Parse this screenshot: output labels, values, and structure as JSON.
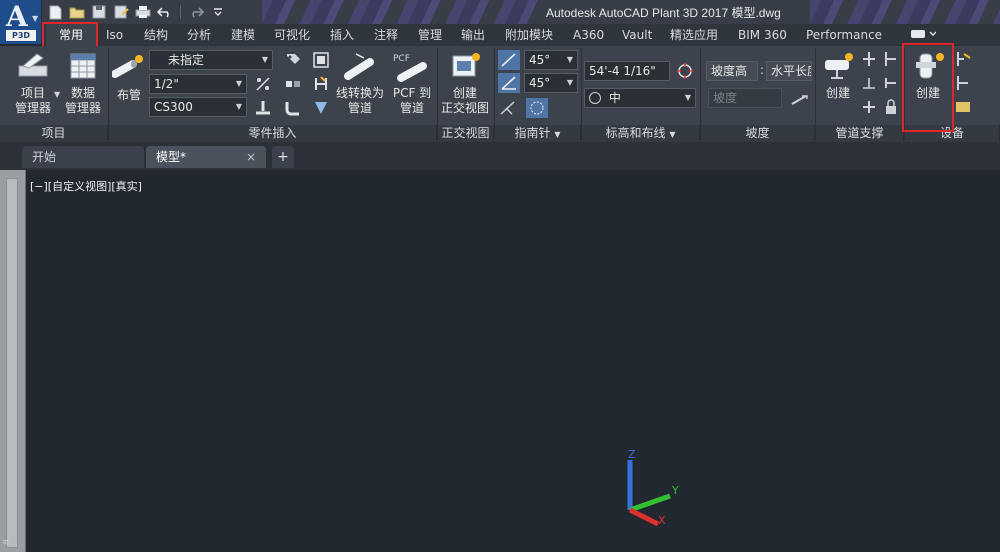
{
  "app": {
    "window_title": "Autodesk AutoCAD Plant 3D 2017    模型.dwg",
    "badge": "P3D",
    "logo_letter": "A"
  },
  "quick_access": {
    "icons": [
      "new-icon",
      "open-icon",
      "save-icon",
      "saveas-icon",
      "print-icon",
      "undo-icon",
      "redo-icon",
      "dropdown-icon"
    ]
  },
  "ribbon_tabs": [
    "常用",
    "Iso",
    "结构",
    "分析",
    "建模",
    "可视化",
    "插入",
    "注释",
    "管理",
    "输出",
    "附加模块",
    "A360",
    "Vault",
    "精选应用",
    "BIM 360",
    "Performance"
  ],
  "active_tab": "常用",
  "panels": {
    "project": {
      "title": "项目",
      "project_manager": "项目\n管理器",
      "data_manager": "数据\n管理器"
    },
    "part_insert": {
      "title": "零件插入",
      "route_pipe": "布管",
      "spec_combo": "未指定",
      "size_combo": "1/2\"",
      "class_combo": "CS300",
      "line_to_pipe": "线转换为\n管道",
      "pcf_to_pipe": "PCF 到\n管道",
      "pcf_label": "PCF"
    },
    "ortho": {
      "title": "正交视图",
      "create_ortho": "创建\n正交视图"
    },
    "compass": {
      "title": "指南针",
      "angle1": "45°",
      "angle2": "45°"
    },
    "elevation": {
      "title": "标高和布线",
      "elevation_value": "54'-4 1/16\"",
      "routing_mode": "中"
    },
    "slope": {
      "title": "坡度",
      "slope_height": "坡度高",
      "horizontal_length": "水平长度",
      "slope_input": "坡度"
    },
    "pipe_support": {
      "title": "管道支撑",
      "create": "创建"
    },
    "equipment": {
      "title": "设备",
      "create": "创建"
    }
  },
  "doc_tabs": {
    "start": "开始",
    "model": "模型*",
    "close": "×",
    "add": "+"
  },
  "viewport": {
    "view_controls": "[−][自定义视图][真实]",
    "axis_x": "X",
    "axis_y": "Y",
    "axis_z": "Z"
  },
  "colors": {
    "highlight": "#e0262a",
    "background": "#212830",
    "ribbon": "#3c434c",
    "axis_x": "#e03030",
    "axis_y": "#30c030",
    "axis_z": "#3a6fe0"
  }
}
